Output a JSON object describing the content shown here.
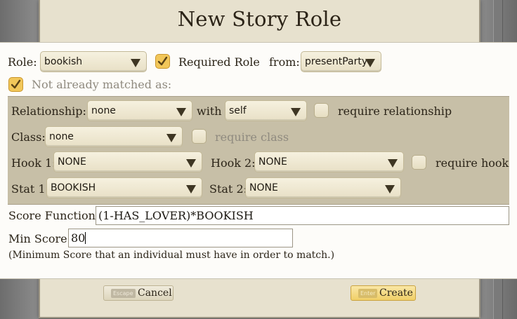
{
  "dialog": {
    "title": "New Story Role"
  },
  "role": {
    "label": "Role:",
    "value": "bookish",
    "required_label": "Required Role",
    "required_checked": true,
    "from_label": "from:",
    "from_value": "presentParty"
  },
  "not_matched": {
    "label": "Not already matched as:",
    "checked": true
  },
  "relationship": {
    "label": "Relationship:",
    "value": "none",
    "with_label": "with",
    "with_value": "self",
    "require_label": "require relationship",
    "require_checked": false
  },
  "class_row": {
    "label": "Class:",
    "value": "none",
    "require_label": "require class",
    "require_checked": false
  },
  "hooks": {
    "hook1_label": "Hook 1:",
    "hook1_value": "NONE",
    "hook2_label": "Hook 2:",
    "hook2_value": "NONE",
    "require_label": "require hook",
    "require_checked": false
  },
  "stats": {
    "stat1_label": "Stat 1:",
    "stat1_value": "BOOKISH",
    "stat2_label": "Stat 2:",
    "stat2_value": "NONE"
  },
  "score_function": {
    "label": "Score Function:",
    "value": "(1-HAS_LOVER)*BOOKISH"
  },
  "min_score": {
    "label": "Min Score:",
    "value": "80",
    "note": "(Minimum Score that an individual must have in order to match.)"
  },
  "buttons": {
    "cancel_key": "Escape",
    "cancel_label": "Cancel",
    "create_key": "Enter",
    "create_label": "Create"
  },
  "colors": {
    "parchment": "#e7e1ce",
    "panel": "#fdfcf9",
    "group_bg": "#c7bfa7",
    "check_on": "#f2c75a",
    "create_button": "#f0cf67"
  }
}
